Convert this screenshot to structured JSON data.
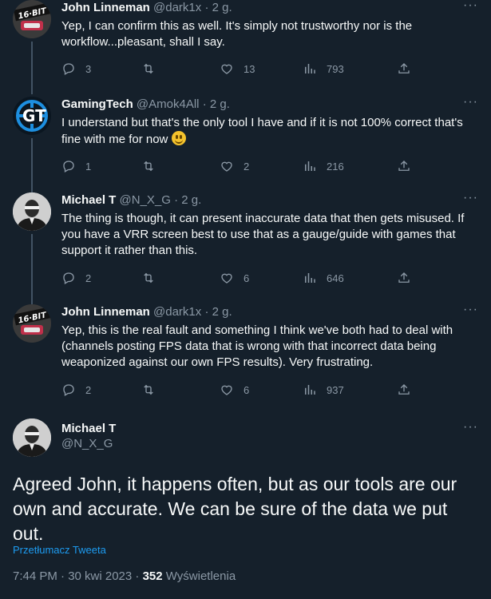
{
  "replies": [
    {
      "name": "John Linneman",
      "handle": "@dark1x",
      "separator": "·",
      "time": "2 g.",
      "text": "Yep, I can confirm this as well. It's simply not trustworthy nor is the workflow...pleasant, shall I say.",
      "counts": {
        "reply": "3",
        "retweet": "",
        "like": "13",
        "views": "793"
      },
      "avatar_label": "16·BIT"
    },
    {
      "name": "GamingTech",
      "handle": "@Amok4All",
      "separator": "·",
      "time": "2 g.",
      "text": "I understand but that's the only tool I have and if it is not 100% correct that's fine with me for now",
      "counts": {
        "reply": "1",
        "retweet": "",
        "like": "2",
        "views": "216"
      },
      "avatar_label": "GT"
    },
    {
      "name": "Michael T",
      "handle": "@N_X_G",
      "separator": "·",
      "time": "2 g.",
      "text": "The thing is though, it can present inaccurate data that then gets misused. If you have a VRR screen best to use that as a gauge/guide with games that support it rather than this.",
      "counts": {
        "reply": "2",
        "retweet": "",
        "like": "6",
        "views": "646"
      }
    },
    {
      "name": "John Linneman",
      "handle": "@dark1x",
      "separator": "·",
      "time": "2 g.",
      "text": "Yep, this is the real fault and something I think we've both had to deal with (channels posting FPS data that is wrong with that incorrect data being weaponized against our own FPS results). Very frustrating.",
      "counts": {
        "reply": "2",
        "retweet": "",
        "like": "6",
        "views": "937"
      },
      "avatar_label": "16·BIT"
    }
  ],
  "main": {
    "name": "Michael T",
    "handle": "@N_X_G",
    "text": "Agreed John, it happens often, but as our tools are our own and accurate. We can be sure of the data we put out.",
    "translate": "Przetłumacz Tweeta",
    "time": "7:44 PM · 30 kwi 2023 · ",
    "views_count": "352",
    "views_label": " Wyświetlenia"
  },
  "icons": {
    "reply": "reply-icon",
    "retweet": "retweet-icon",
    "like": "like-icon",
    "views": "views-icon",
    "share": "share-icon",
    "more": "more-icon"
  },
  "colors": {
    "background": "#15202b",
    "text": "#f7f9f9",
    "muted": "#8b98a5",
    "link": "#1d9bf0"
  }
}
